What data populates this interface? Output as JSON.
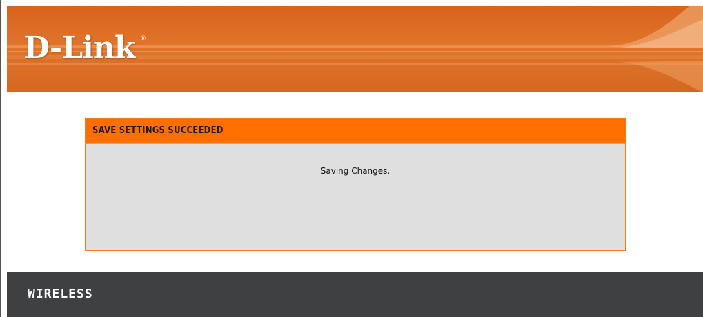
{
  "header": {
    "logo_text": "D-Link",
    "logo_mark": "®",
    "brand_color": "#dd6a23"
  },
  "dialog": {
    "title": "SAVE SETTINGS SUCCEEDED",
    "message": "Saving Changes.",
    "title_bg_color": "#ff6f00",
    "body_bg_color": "#dfdfdf"
  },
  "footer": {
    "label": "WIRELESS",
    "bg_color": "#3f4042"
  }
}
